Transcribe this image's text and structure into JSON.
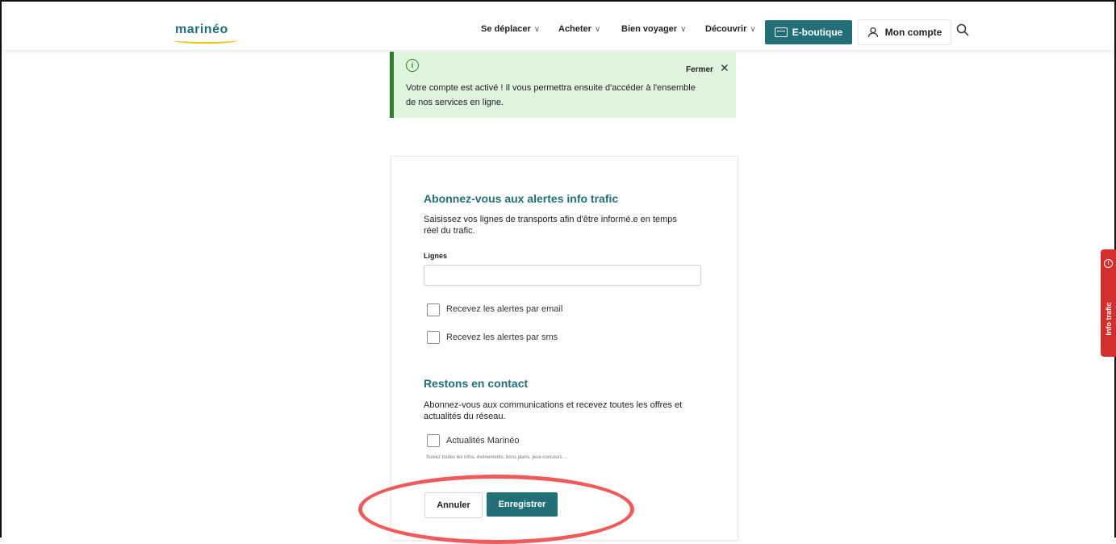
{
  "header": {
    "logo_text": "marinéo",
    "nav": [
      {
        "label": "Se déplacer"
      },
      {
        "label": "Acheter"
      },
      {
        "label": "Bien voyager"
      },
      {
        "label": "Découvrir"
      }
    ],
    "eboutique_label": "E-boutique",
    "account_label": "Mon compte"
  },
  "alert": {
    "close_label": "Fermer",
    "message": "Votre compte est activé ! Il vous permettra ensuite d'accéder à l'ensemble de nos services en ligne."
  },
  "traffic_alerts": {
    "title": "Abonnez-vous aux alertes info trafic",
    "description": "Saisissez vos lignes de transports afin d'être informé.e en temps réel du trafic.",
    "lines_label": "Lignes",
    "lines_value": "",
    "email_option": "Recevez les alertes par email",
    "sms_option": "Recevez les alertes par sms"
  },
  "contact": {
    "title": "Restons en contact",
    "description": "Abonnez-vous aux communications et recevez toutes les offres et actualités du réseau.",
    "news_option": "Actualités Marinéo",
    "news_hint": "Suivez toutes les infos, évènements, bons plans, jeux-concours ..."
  },
  "actions": {
    "cancel_label": "Annuler",
    "save_label": "Enregistrer"
  },
  "side_tab": {
    "label": "Info trafic"
  },
  "colors": {
    "brand_teal": "#236f77",
    "alert_bg": "#dff5dd",
    "alert_border": "#2e7d32",
    "side_tab": "#d32f2f",
    "highlight_ring": "#ef5b5b"
  }
}
